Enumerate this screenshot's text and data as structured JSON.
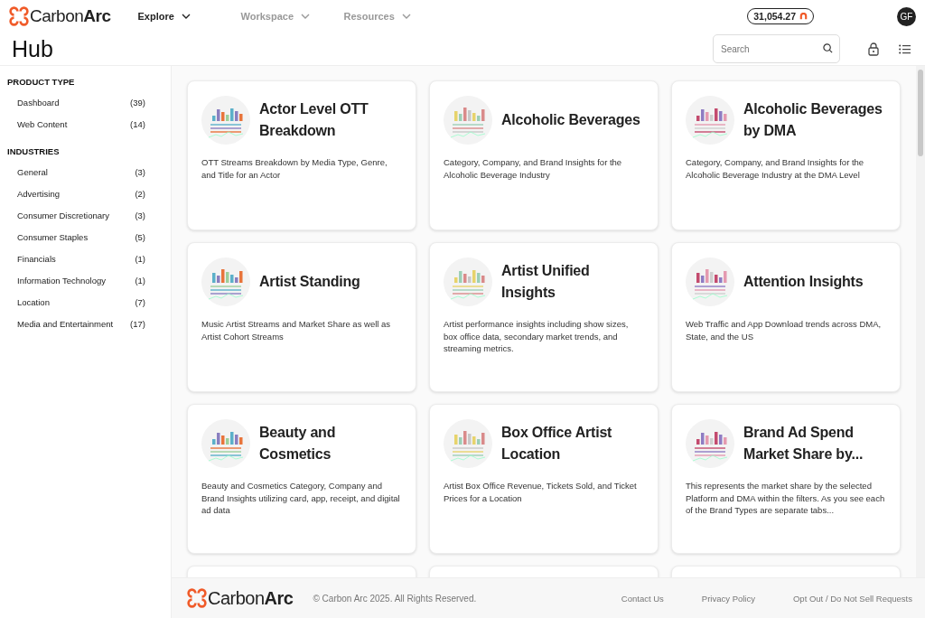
{
  "header": {
    "logo": "Carbon**Arc**",
    "nav": [
      {
        "label": "Explore",
        "selected": true
      },
      {
        "label": "Workspace",
        "selected": false
      },
      {
        "label": "Resources",
        "selected": false
      }
    ],
    "credits": "31,054.27",
    "avatar": "GF"
  },
  "page": {
    "title": "Hub",
    "search": {
      "placeholder": "Search"
    }
  },
  "sidebar": {
    "sections": [
      {
        "heading": "PRODUCT TYPE",
        "items": [
          {
            "label": "Dashboard",
            "count": "(39)"
          },
          {
            "label": "Web Content",
            "count": "(14)"
          }
        ]
      },
      {
        "heading": "INDUSTRIES",
        "items": [
          {
            "label": "General",
            "count": "(3)"
          },
          {
            "label": "Advertising",
            "count": "(2)"
          },
          {
            "label": "Consumer Discretionary",
            "count": "(3)"
          },
          {
            "label": "Consumer Staples",
            "count": "(5)"
          },
          {
            "label": "Financials",
            "count": "(1)"
          },
          {
            "label": "Information Technology",
            "count": "(1)"
          },
          {
            "label": "Location",
            "count": "(7)"
          },
          {
            "label": "Media and Entertainment",
            "count": "(17)"
          }
        ]
      }
    ]
  },
  "cards": [
    {
      "title": "Actor Level OTT Breakdown",
      "description": "OTT Streams Breakdown by Media Type, Genre, and Title for an Actor"
    },
    {
      "title": "Alcoholic Beverages",
      "description": "Category, Company, and Brand Insights for the Alcoholic Beverage Industry"
    },
    {
      "title": "Alcoholic Beverages by DMA",
      "description": "Category, Company, and Brand Insights for the Alcoholic Beverage Industry at the DMA Level"
    },
    {
      "title": "Artist Standing",
      "description": "Music Artist Streams and Market Share as well as Artist Cohort Streams"
    },
    {
      "title": "Artist Unified Insights",
      "description": "Artist performance insights including show sizes, box office data, secondary market trends, and streaming metrics."
    },
    {
      "title": "Attention Insights",
      "description": "Web Traffic and App Download trends across DMA, State, and the US"
    },
    {
      "title": "Beauty and Cosmetics",
      "description": "Beauty and Cosmetics Category, Company and Brand Insights utilizing card, app, receipt, and digital ad data"
    },
    {
      "title": "Box Office Artist Location",
      "description": "Artist Box Office Revenue, Tickets Sold, and Ticket Prices for a Location"
    },
    {
      "title": "Brand Ad Spend Market Share by...",
      "description": "This represents the market share by the selected Platform and DMA within the filters. As you see each of the Brand Types are separate tabs..."
    }
  ],
  "footer": {
    "logo": "Carbon**Arc**",
    "copyright": "© Carbon Arc 2025. All Rights Reserved.",
    "links": [
      "Contact Us",
      "Privacy Policy",
      "Opt Out / Do Not Sell Requests"
    ]
  }
}
